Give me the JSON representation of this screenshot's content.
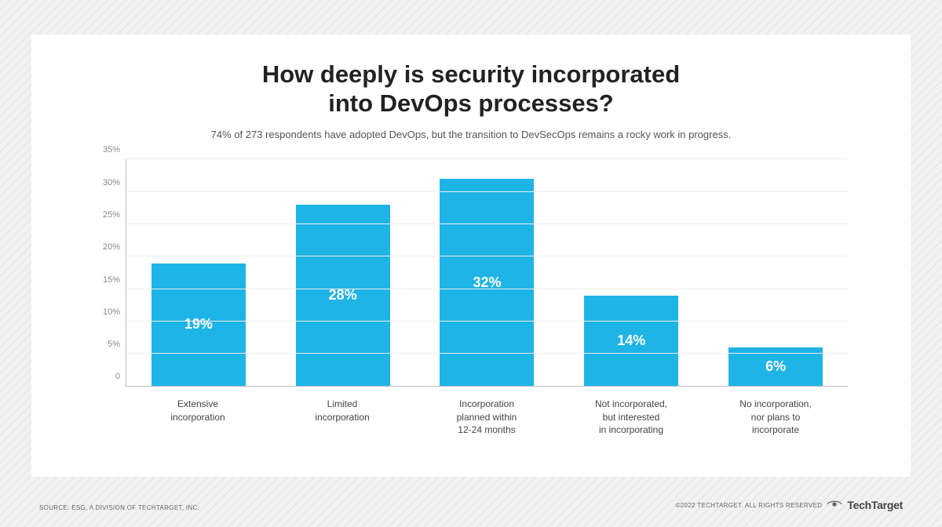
{
  "title_line1": "How deeply is security incorporated",
  "title_line2": "into DevOps processes?",
  "subtitle": "74% of 273 respondents have adopted DevOps, but the transition to DevSecOps remains a rocky work in progress.",
  "source_text": "SOURCE: ESG, A DIVISION OF TECHTARGET, INC.",
  "copyright_text": "©2022 TECHTARGET. ALL RIGHTS RESERVED",
  "brand_name": "TechTarget",
  "colors": {
    "bar_fill": "#1eb4e6",
    "text_dark": "#222222"
  },
  "chart_data": {
    "type": "bar",
    "title": "How deeply is security incorporated into DevOps processes?",
    "xlabel": "",
    "ylabel": "",
    "ylim": [
      0,
      35
    ],
    "y_ticks": [
      0,
      5,
      10,
      15,
      20,
      25,
      30,
      35
    ],
    "y_tick_labels": [
      "0",
      "5%",
      "10%",
      "15%",
      "20%",
      "25%",
      "30%",
      "35%"
    ],
    "categories": [
      "Extensive incorporation",
      "Limited incorporation",
      "Incorporation planned within 12-24 months",
      "Not incorporated, but interested in incorporating",
      "No incorporation, nor plans to incorporate"
    ],
    "category_labels_multiline": [
      [
        "Extensive",
        "incorporation"
      ],
      [
        "Limited",
        "incorporation"
      ],
      [
        "Incorporation",
        "planned within",
        "12-24 months"
      ],
      [
        "Not incorporated,",
        "but interested",
        "in incorporating"
      ],
      [
        "No incorporation,",
        "nor plans to",
        "incorporate"
      ]
    ],
    "values": [
      19,
      28,
      32,
      14,
      6
    ],
    "value_labels": [
      "19%",
      "28%",
      "32%",
      "14%",
      "6%"
    ]
  }
}
